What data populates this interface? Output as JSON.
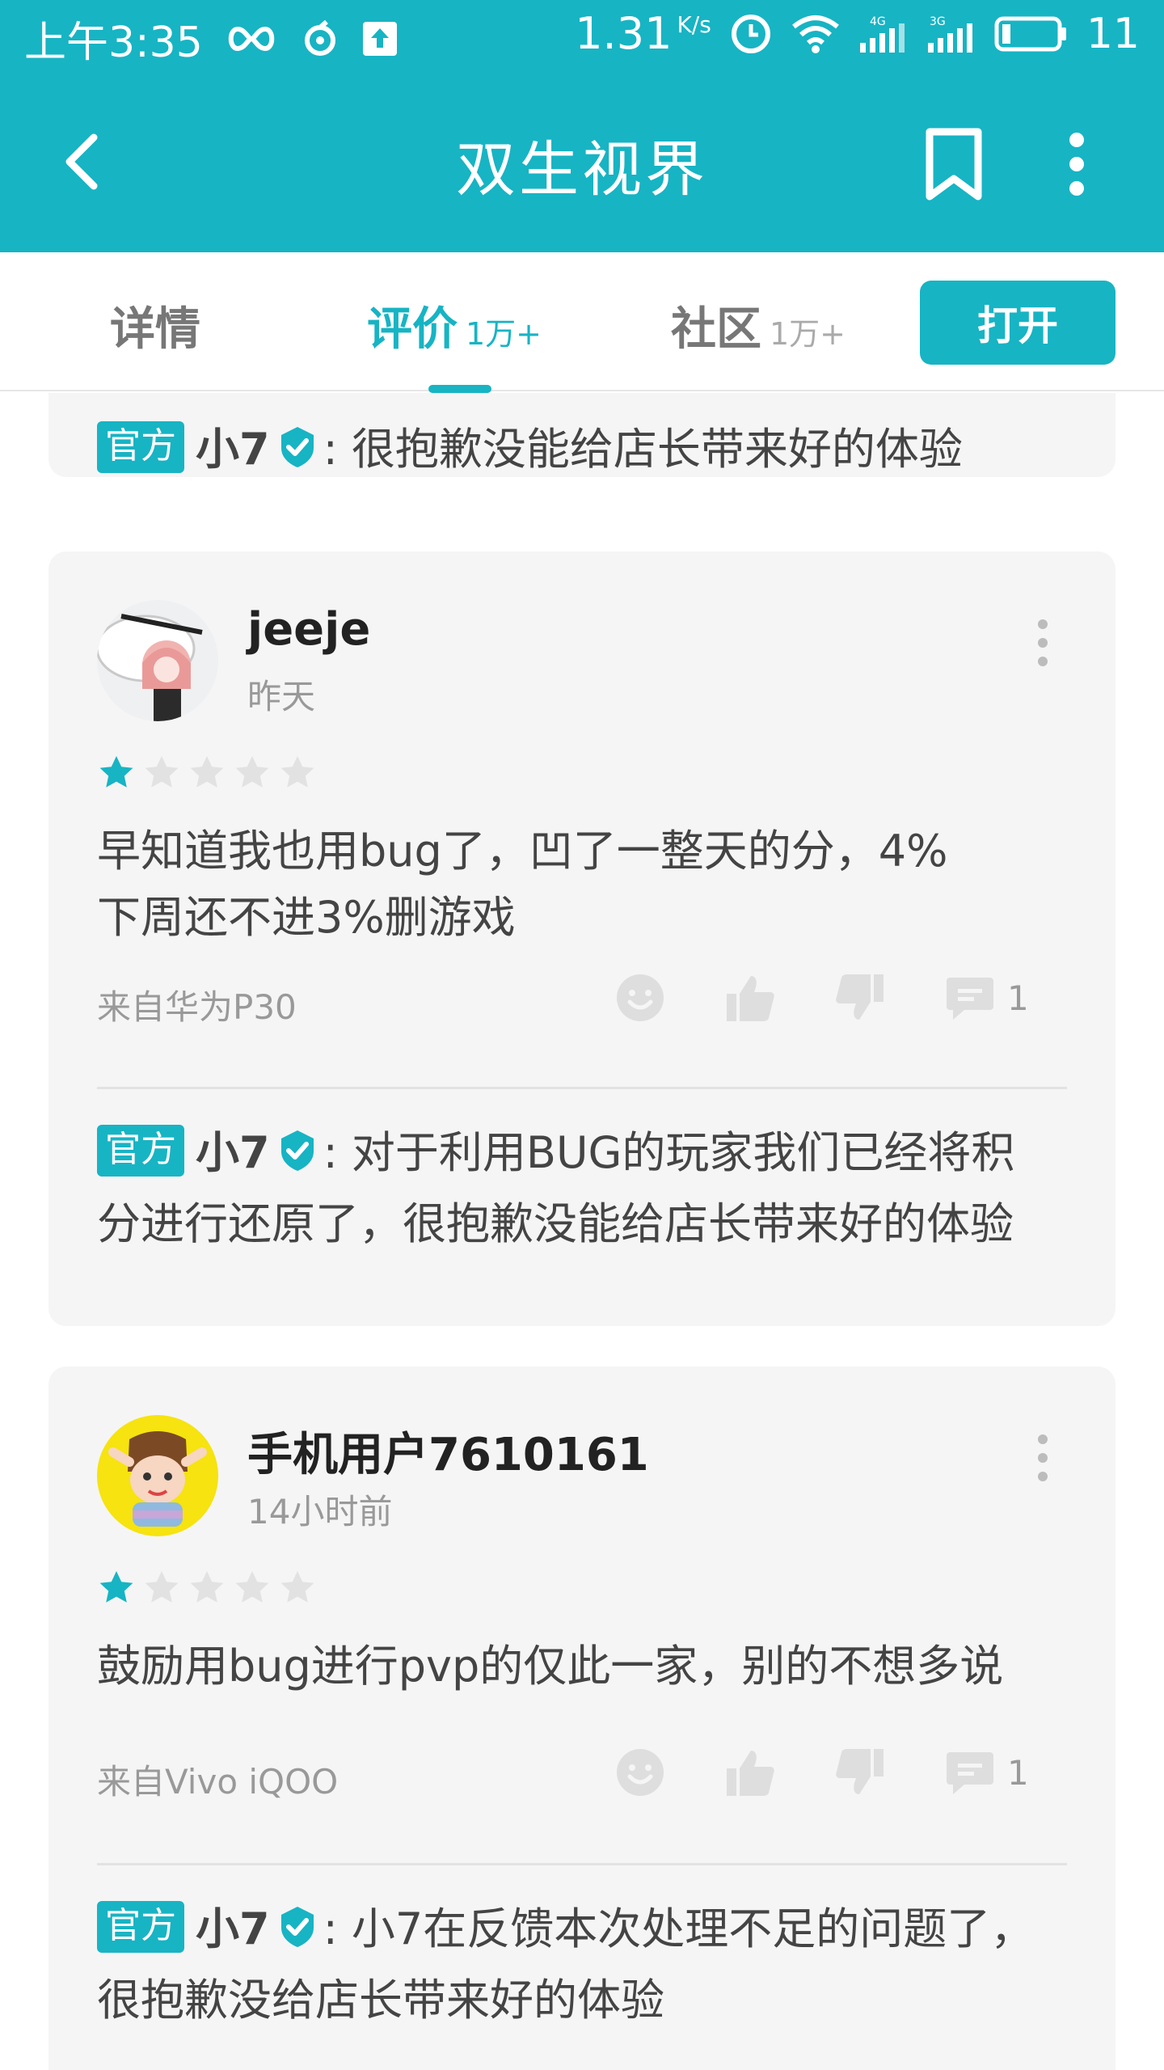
{
  "status_bar": {
    "time": "上午3:35",
    "speed": "1.31",
    "speed_unit": "K/s",
    "net_4g": "4G",
    "net_3g": "3G",
    "battery": "11"
  },
  "header": {
    "title": "双生视界",
    "color": "#17b4c4"
  },
  "tabs": [
    {
      "label": "详情",
      "count": ""
    },
    {
      "label": "评价",
      "count": "1万+"
    },
    {
      "label": "社区",
      "count": "1万+"
    }
  ],
  "open_button": "打开",
  "top_reply": {
    "badge": "官方",
    "name": "小7",
    "text": ": 很抱歉没能给店长带来好的体验"
  },
  "reviews": [
    {
      "user": "jeeje",
      "time": "昨天",
      "rating": 1,
      "max_rating": 5,
      "text_lines": [
        "早知道我也用bug了，凹了一整天的分，4%",
        "下周还不进3%删游戏"
      ],
      "device": "来自华为P30",
      "comments": "1",
      "reply": {
        "badge": "官方",
        "name": "小7",
        "line1": ": 对于利用BUG的玩家我们已经将积",
        "line2": "分进行还原了，很抱歉没能给店长带来好的体验"
      }
    },
    {
      "user": "手机用户7610161",
      "time": "14小时前",
      "rating": 1,
      "max_rating": 5,
      "text_lines": [
        "鼓励用bug进行pvp的仅此一家，别的不想多说"
      ],
      "device": "来自Vivo iQOO",
      "comments": "1",
      "reply": {
        "badge": "官方",
        "name": "小7",
        "line1": ": 小7在反馈本次处理不足的问题了，",
        "line2": "很抱歉没给店长带来好的体验"
      }
    }
  ]
}
